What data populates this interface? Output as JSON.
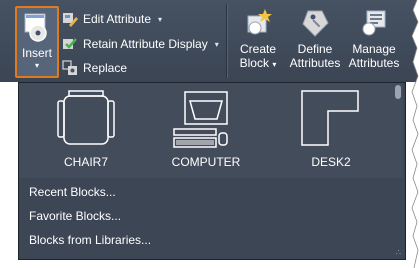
{
  "ribbon": {
    "insert": {
      "label": "Insert",
      "caret": "▾",
      "icon": "block-insert-icon"
    },
    "commands": [
      {
        "label": "Edit Attribute",
        "icon": "edit-attribute-icon",
        "has_dropdown": true
      },
      {
        "label": "Retain Attribute Display",
        "icon": "retain-attribute-icon",
        "has_dropdown": true
      },
      {
        "label": "Replace",
        "icon": "replace-icon",
        "has_dropdown": false
      }
    ],
    "create_block": {
      "line1": "Create",
      "line2": "Block",
      "caret": "▾",
      "icon": "create-block-icon"
    },
    "define_attributes": {
      "line1": "Define",
      "line2": "Attributes",
      "icon": "define-attributes-icon"
    },
    "manage_attributes": {
      "line1": "Manage",
      "line2": "Attributes",
      "icon": "manage-attributes-icon"
    }
  },
  "gallery": {
    "blocks": [
      {
        "name": "CHAIR7",
        "icon": "chair-block-icon"
      },
      {
        "name": "COMPUTER",
        "icon": "computer-block-icon"
      },
      {
        "name": "DESK2",
        "icon": "desk-block-icon"
      }
    ],
    "menu": [
      "Recent Blocks...",
      "Favorite Blocks...",
      "Blocks from Libraries..."
    ],
    "grip": "∴"
  },
  "colors": {
    "ribbon_bg": "#3f4958",
    "panel_bg": "#3d4655",
    "highlight_border": "#e07a1c",
    "text": "#ffffff"
  }
}
